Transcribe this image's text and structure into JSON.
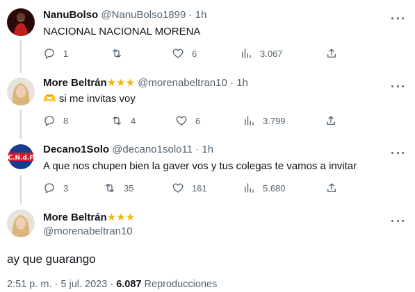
{
  "tweets": [
    {
      "name": "NanuBolso",
      "handle": "@NanuBolso1899",
      "separator": "·",
      "time": "1h",
      "text": "NACIONAL NACIONAL MORENA",
      "replies": "1",
      "retweets": "",
      "likes": "6",
      "views": "3.067",
      "avatar_colors": [
        "#3a0b0b",
        "#b3201f"
      ]
    },
    {
      "name": "More Beltrán",
      "stars": "★★★",
      "handle": "@morenabeltran10",
      "separator": "·",
      "time": "1h",
      "emoji": "🫶",
      "text": "si me invitas voy",
      "replies": "8",
      "retweets": "4",
      "likes": "6",
      "views": "3.799"
    },
    {
      "name": "Decano1Solo",
      "handle": "@decano1solo11",
      "separator": "·",
      "time": "1h",
      "text": "A que nos chupen bien la gaver vos y tus colegas te vamos a invitar",
      "replies": "3",
      "retweets": "35",
      "likes": "161",
      "views": "5.680",
      "avatar_text": "C.N.d.F"
    }
  ],
  "main_tweet": {
    "name": "More Beltrán",
    "stars": "★★★",
    "handle": "@morenabeltran10",
    "text": "ay que guarango",
    "time": "2:51 p. m.",
    "separator": "·",
    "date": "5 jul. 2023",
    "views": "6.087",
    "views_label": "Reproducciones"
  },
  "icons": {
    "reply": "reply-icon",
    "retweet": "retweet-icon",
    "like": "heart-icon",
    "views": "views-icon",
    "share": "share-icon",
    "more": "more-icon"
  },
  "colors": {
    "text": "#0f1419",
    "secondary": "#536471",
    "star": "#f4b400",
    "thread": "#cfd9de"
  }
}
